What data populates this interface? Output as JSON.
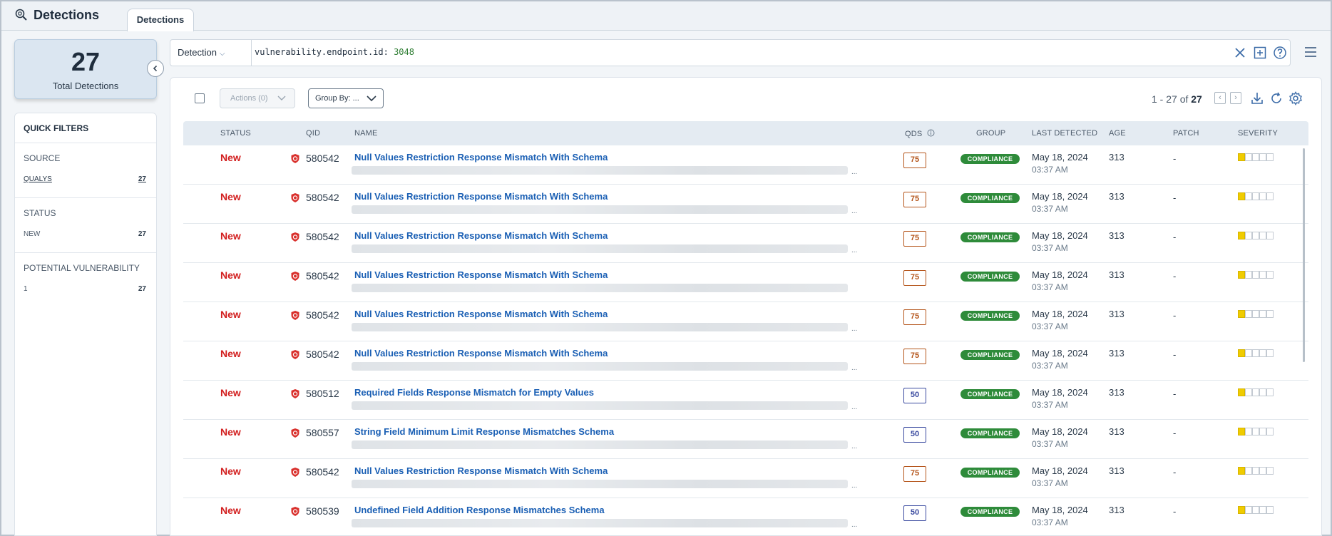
{
  "app": {
    "title": "Detections",
    "icon": "search-detections-icon"
  },
  "tabs": [
    {
      "label": "Detections",
      "active": true
    }
  ],
  "summary": {
    "count": "27",
    "label": "Total Detections"
  },
  "quick_filters": {
    "title": "QUICK FILTERS",
    "sections": [
      {
        "title": "SOURCE",
        "items": [
          {
            "label": "QUALYS",
            "count": "27"
          }
        ]
      },
      {
        "title": "STATUS",
        "items": [
          {
            "label": "NEW",
            "count": "27"
          }
        ]
      },
      {
        "title": "POTENTIAL VULNERABILITY",
        "items": [
          {
            "label": "1",
            "count": "27"
          }
        ]
      }
    ]
  },
  "search": {
    "type_label": "Detection",
    "query_key": "vulnerability.endpoint.id:",
    "query_value": "3048"
  },
  "toolbar": {
    "actions_label": "Actions (0)",
    "groupby_label": "Group By: ...",
    "pagination_range": "1 - 27 of",
    "pagination_total": "27"
  },
  "columns": [
    "STATUS",
    "QID",
    "NAME",
    "QDS",
    "GROUP",
    "LAST DETECTED",
    "AGE",
    "PATCH",
    "SEVERITY"
  ],
  "severity_scale": 5,
  "colors": {
    "status_new": "#d21f1f",
    "qds_high": "#b5561c",
    "qds_medium": "#3a4aa0",
    "group_badge": "#2e8b3a",
    "severity_on": "#f0cc00",
    "link": "#1a5fb4"
  },
  "rows": [
    {
      "status": "New",
      "qid": "580542",
      "name": "Null Values Restriction Response Mismatch With Schema",
      "ellipsis": "...",
      "qds": "75",
      "qds_level": "high",
      "group": "COMPLIANCE",
      "date": "May 18, 2024",
      "time": "03:37 AM",
      "age": "313",
      "patch": "-",
      "severity": 1
    },
    {
      "status": "New",
      "qid": "580542",
      "name": "Null Values Restriction Response Mismatch With Schema",
      "ellipsis": "...",
      "qds": "75",
      "qds_level": "high",
      "group": "COMPLIANCE",
      "date": "May 18, 2024",
      "time": "03:37 AM",
      "age": "313",
      "patch": "-",
      "severity": 1
    },
    {
      "status": "New",
      "qid": "580542",
      "name": "Null Values Restriction Response Mismatch With Schema",
      "ellipsis": "...",
      "qds": "75",
      "qds_level": "high",
      "group": "COMPLIANCE",
      "date": "May 18, 2024",
      "time": "03:37 AM",
      "age": "313",
      "patch": "-",
      "severity": 1
    },
    {
      "status": "New",
      "qid": "580542",
      "name": "Null Values Restriction Response Mismatch With Schema",
      "ellipsis": "",
      "qds": "75",
      "qds_level": "high",
      "group": "COMPLIANCE",
      "date": "May 18, 2024",
      "time": "03:37 AM",
      "age": "313",
      "patch": "-",
      "severity": 1
    },
    {
      "status": "New",
      "qid": "580542",
      "name": "Null Values Restriction Response Mismatch With Schema",
      "ellipsis": "...",
      "qds": "75",
      "qds_level": "high",
      "group": "COMPLIANCE",
      "date": "May 18, 2024",
      "time": "03:37 AM",
      "age": "313",
      "patch": "-",
      "severity": 1
    },
    {
      "status": "New",
      "qid": "580542",
      "name": "Null Values Restriction Response Mismatch With Schema",
      "ellipsis": "...",
      "qds": "75",
      "qds_level": "high",
      "group": "COMPLIANCE",
      "date": "May 18, 2024",
      "time": "03:37 AM",
      "age": "313",
      "patch": "-",
      "severity": 1
    },
    {
      "status": "New",
      "qid": "580512",
      "name": "Required Fields Response Mismatch for Empty Values",
      "ellipsis": "...",
      "qds": "50",
      "qds_level": "medium",
      "group": "COMPLIANCE",
      "date": "May 18, 2024",
      "time": "03:37 AM",
      "age": "313",
      "patch": "-",
      "severity": 1
    },
    {
      "status": "New",
      "qid": "580557",
      "name": "String Field Minimum Limit Response Mismatches Schema",
      "ellipsis": "...",
      "qds": "50",
      "qds_level": "medium",
      "group": "COMPLIANCE",
      "date": "May 18, 2024",
      "time": "03:37 AM",
      "age": "313",
      "patch": "-",
      "severity": 1
    },
    {
      "status": "New",
      "qid": "580542",
      "name": "Null Values Restriction Response Mismatch With Schema",
      "ellipsis": "...",
      "qds": "75",
      "qds_level": "high",
      "group": "COMPLIANCE",
      "date": "May 18, 2024",
      "time": "03:37 AM",
      "age": "313",
      "patch": "-",
      "severity": 1
    },
    {
      "status": "New",
      "qid": "580539",
      "name": "Undefined Field Addition Response Mismatches Schema",
      "ellipsis": "...",
      "qds": "50",
      "qds_level": "medium",
      "group": "COMPLIANCE",
      "date": "May 18, 2024",
      "time": "03:37 AM",
      "age": "313",
      "patch": "-",
      "severity": 1
    }
  ]
}
